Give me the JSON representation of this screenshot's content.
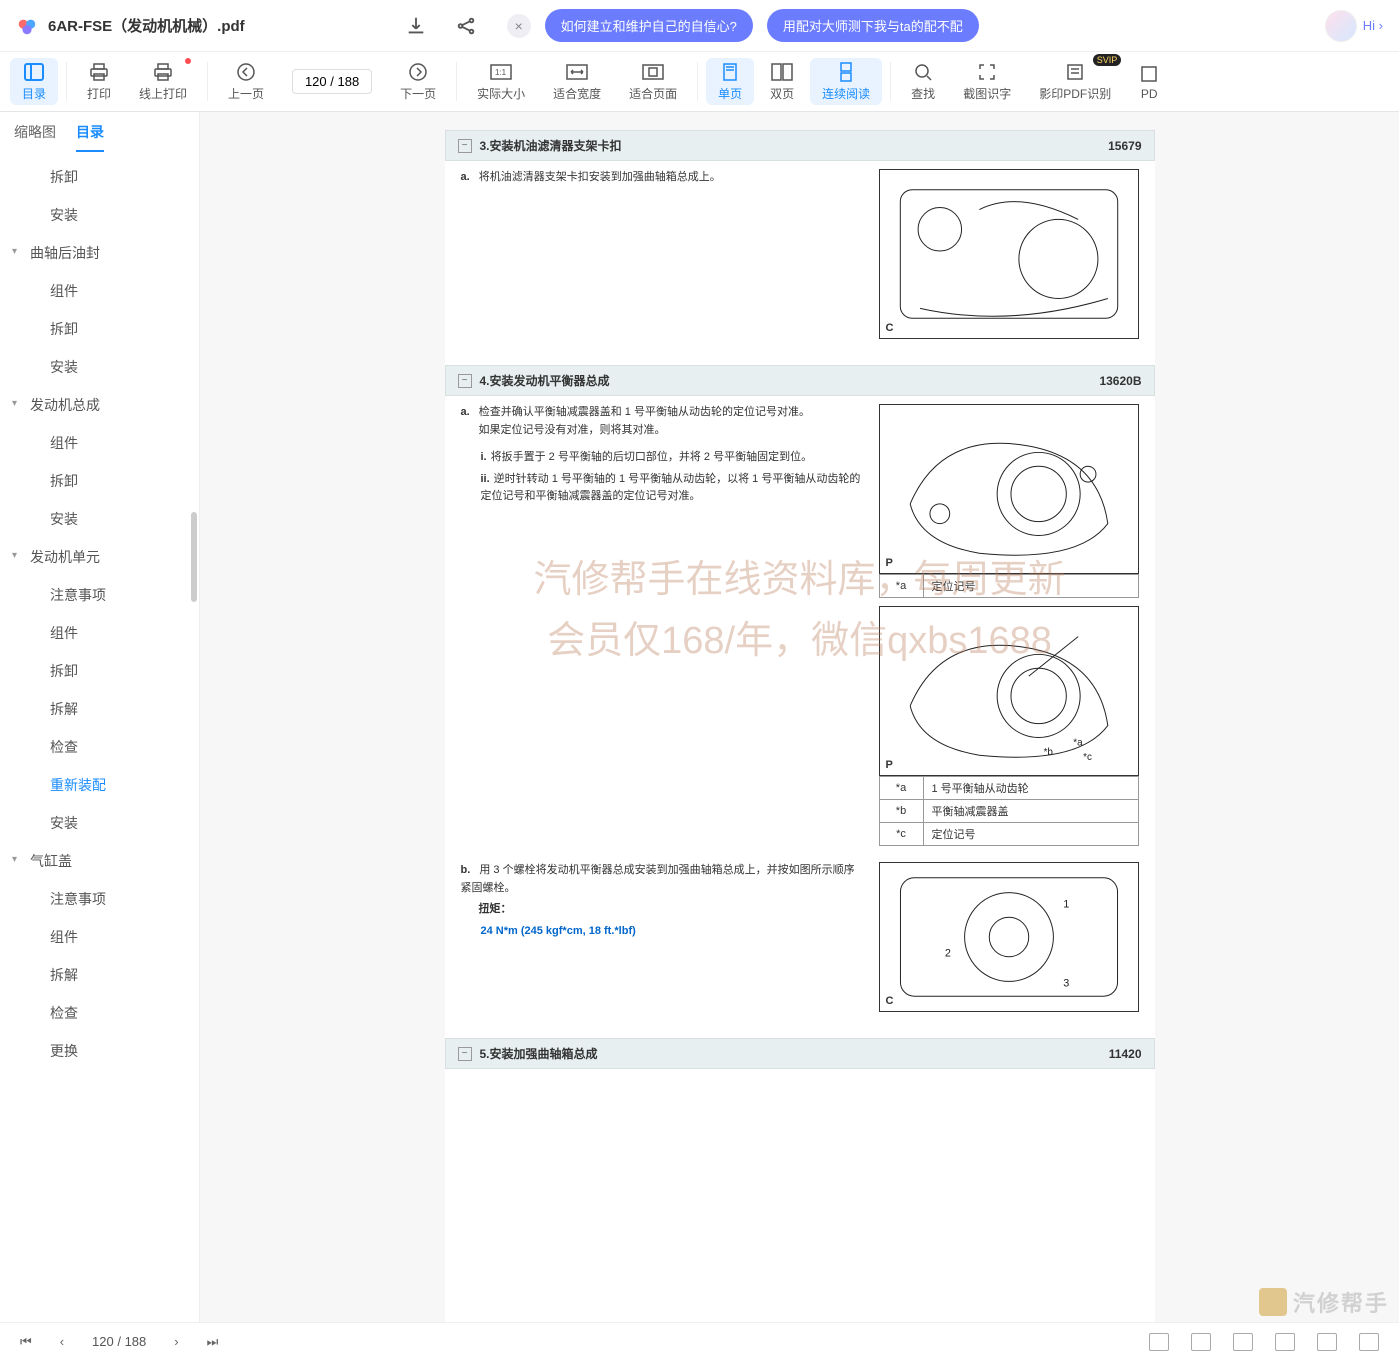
{
  "header": {
    "file_title": "6AR-FSE（发动机机械）.pdf",
    "pill_close": "×",
    "pill1": "如何建立和维护自己的自信心?",
    "pill2": "用配对大师测下我与ta的配不配",
    "hi": "Hi ›"
  },
  "toolbar": {
    "catalog": "目录",
    "print": "打印",
    "online_print": "线上打印",
    "prev_page": "上一页",
    "page_input": "120 / 188",
    "next_page": "下一页",
    "actual_size": "实际大小",
    "fit_width": "适合宽度",
    "fit_page": "适合页面",
    "single_page": "单页",
    "double_page": "双页",
    "continuous": "连续阅读",
    "search": "查找",
    "screenshot_ocr": "截图识字",
    "shadow_pdf": "影印PDF识别",
    "pdf_more": "PD",
    "svip": "SVIP"
  },
  "sidebar": {
    "tab_thumb": "缩略图",
    "tab_toc": "目录",
    "items": [
      {
        "label": "拆卸",
        "level": 1
      },
      {
        "label": "安装",
        "level": 1
      },
      {
        "label": "曲轴后油封",
        "level": 0,
        "expand": true
      },
      {
        "label": "组件",
        "level": 1
      },
      {
        "label": "拆卸",
        "level": 1
      },
      {
        "label": "安装",
        "level": 1
      },
      {
        "label": "发动机总成",
        "level": 0,
        "expand": true
      },
      {
        "label": "组件",
        "level": 1
      },
      {
        "label": "拆卸",
        "level": 1
      },
      {
        "label": "安装",
        "level": 1
      },
      {
        "label": "发动机单元",
        "level": 0,
        "expand": true
      },
      {
        "label": "注意事项",
        "level": 1
      },
      {
        "label": "组件",
        "level": 1
      },
      {
        "label": "拆卸",
        "level": 1
      },
      {
        "label": "拆解",
        "level": 1
      },
      {
        "label": "检查",
        "level": 1
      },
      {
        "label": "重新装配",
        "level": 1,
        "active": true
      },
      {
        "label": "安装",
        "level": 1
      },
      {
        "label": "气缸盖",
        "level": 0,
        "expand": true
      },
      {
        "label": "注意事项",
        "level": 1
      },
      {
        "label": "组件",
        "level": 1
      },
      {
        "label": "拆解",
        "level": 1
      },
      {
        "label": "检查",
        "level": 1
      },
      {
        "label": "更换",
        "level": 1
      }
    ]
  },
  "doc": {
    "sections": [
      {
        "num": "3",
        "title": "3.安装机油滤清器支架卡扣",
        "code": "15679",
        "rows": [
          {
            "letter": "a.",
            "text": "将机油滤清器支架卡扣安装到加强曲轴箱总成上。",
            "image_label": "C"
          }
        ]
      },
      {
        "num": "4",
        "title": "4.安装发动机平衡器总成",
        "code": "13620B",
        "rows": [
          {
            "letter": "a.",
            "text": "检查并确认平衡轴减震器盖和 1 号平衡轴从动齿轮的定位记号对准。",
            "text2": "如果定位记号没有对准，则将其对准。",
            "image_label": "P",
            "annot_row": {
              "k": "*a",
              "v": "定位记号"
            },
            "sub": [
              {
                "k": "i.",
                "v": "将扳手置于 2 号平衡轴的后切口部位，并将 2 号平衡轴固定到位。"
              },
              {
                "k": "ii.",
                "v": "逆时针转动 1 号平衡轴的 1 号平衡轴从动齿轮，以将 1 号平衡轴从动齿轮的定位记号和平衡轴减震器盖的定位记号对准。"
              }
            ],
            "image2_label": "P",
            "table": [
              {
                "k": "*a",
                "v": "1 号平衡轴从动齿轮"
              },
              {
                "k": "*b",
                "v": "平衡轴减震器盖"
              },
              {
                "k": "*c",
                "v": "定位记号"
              }
            ]
          },
          {
            "letter": "b.",
            "text": "用 3 个螺栓将发动机平衡器总成安装到加强曲轴箱总成上，并按如图所示顺序紧固螺栓。",
            "torque_label": "扭矩：",
            "torque": "24 N*m (245 kgf*cm, 18 ft.*lbf)",
            "image_label": "C"
          }
        ]
      },
      {
        "num": "5",
        "title": "5.安装加强曲轴箱总成",
        "code": "11420"
      }
    ],
    "watermark_l1": "汽修帮手在线资料库，每周更新",
    "watermark_l2": "会员仅168/年，微信qxbs1688"
  },
  "bottom": {
    "page": "120 / 188",
    "brand": "汽修帮手"
  }
}
